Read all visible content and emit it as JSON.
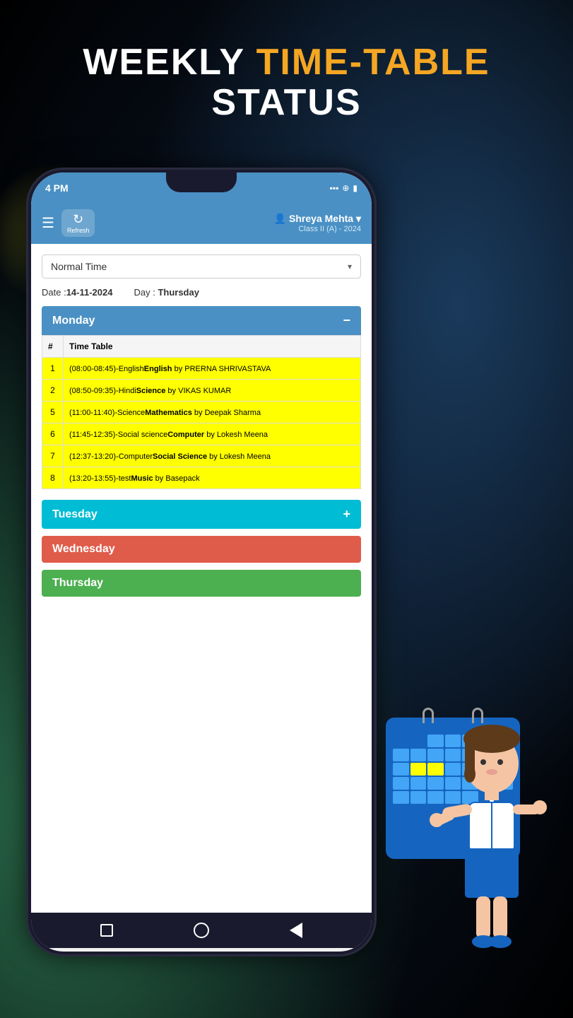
{
  "page": {
    "title_weekly": "WEEKLY ",
    "title_timetable": "TIME-TABLE",
    "title_status": "STATUS"
  },
  "status_bar": {
    "time": "4 PM",
    "signal": "...",
    "wifi": "WiFi",
    "battery": "●"
  },
  "app_header": {
    "refresh_label": "Refresh",
    "user_icon": "👤",
    "user_name": "Shreya Mehta",
    "user_class": "Class II (A) - 2024"
  },
  "filter": {
    "dropdown_value": "Normal Time",
    "dropdown_arrow": "▾"
  },
  "date_info": {
    "date_label": "Date :",
    "date_value": "14-11-2024",
    "day_label": "Day :",
    "day_value": "Thursday"
  },
  "days": [
    {
      "name": "Monday",
      "color": "blue",
      "expanded": true,
      "toggle": "−",
      "entries": [
        {
          "num": "1",
          "time": "(08:00-08:45)-English",
          "subject_bold": "English",
          "rest": " by PRERNA SHRIVASTAVA"
        },
        {
          "num": "2",
          "time": "(08:50-09:35)-Hindi",
          "subject_bold": "Science",
          "rest": " by VIKAS KUMAR"
        },
        {
          "num": "5",
          "time": "(11:00-11:40)-Science",
          "subject_bold": "Mathematics",
          "rest": " by Deepak Sharma"
        },
        {
          "num": "6",
          "time": "(11:45-12:35)-Social science",
          "subject_bold": "Computer",
          "rest": " by Lokesh Meena"
        },
        {
          "num": "7",
          "time": "(12:37-13:20)-Computer",
          "subject_bold": "Social Science",
          "rest": " by Lokesh Meena"
        },
        {
          "num": "8",
          "time": "(13:20-13:55)-test",
          "subject_bold": "Music",
          "rest": " by Basepack"
        }
      ]
    },
    {
      "name": "Tuesday",
      "color": "cyan",
      "expanded": false,
      "toggle": "+"
    },
    {
      "name": "Wednesday",
      "color": "red",
      "expanded": false,
      "toggle": ""
    },
    {
      "name": "Thursday",
      "color": "green",
      "expanded": false,
      "toggle": ""
    }
  ],
  "table_headers": {
    "col1": "#",
    "col2": "Time Table"
  },
  "bottom_nav": {
    "square": "□",
    "circle": "○",
    "triangle": "◁"
  }
}
